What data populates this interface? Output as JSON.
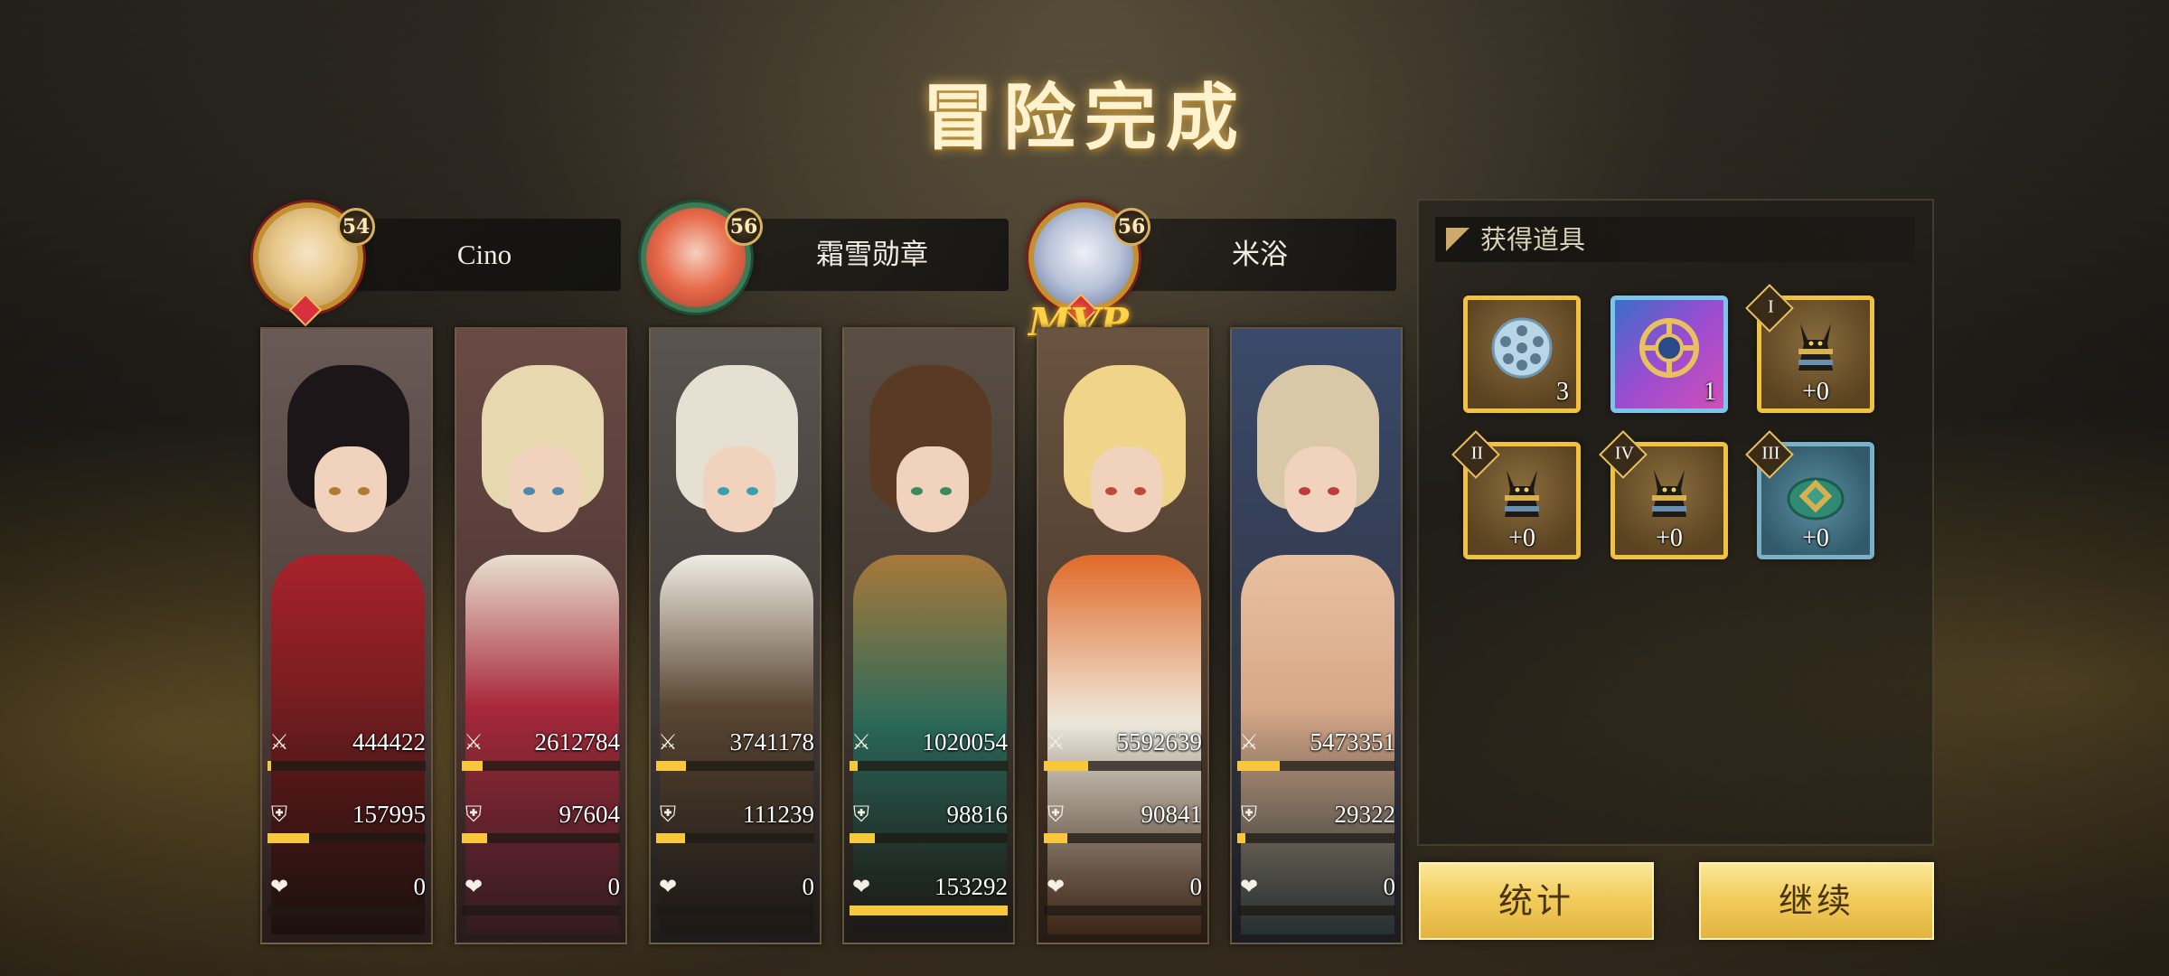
{
  "title": "冒险完成",
  "mvp_label": "MVP",
  "players": [
    {
      "name": "Cino",
      "level": "54"
    },
    {
      "name": "霜雪勋章",
      "level": "56"
    },
    {
      "name": "米浴",
      "level": "56"
    }
  ],
  "heroes": [
    {
      "damage": "444422",
      "damage_fill": 0.02,
      "defense": "157995",
      "defense_fill": 0.26,
      "heal": "0",
      "heal_fill": 0
    },
    {
      "damage": "2612784",
      "damage_fill": 0.13,
      "defense": "97604",
      "defense_fill": 0.16,
      "heal": "0",
      "heal_fill": 0
    },
    {
      "damage": "3741178",
      "damage_fill": 0.19,
      "defense": "111239",
      "defense_fill": 0.18,
      "heal": "0",
      "heal_fill": 0
    },
    {
      "damage": "1020054",
      "damage_fill": 0.05,
      "defense": "98816",
      "defense_fill": 0.16,
      "heal": "153292",
      "heal_fill": 1.0
    },
    {
      "damage": "5592639",
      "damage_fill": 0.28,
      "defense": "90841",
      "defense_fill": 0.15,
      "heal": "0",
      "heal_fill": 0
    },
    {
      "damage": "5473351",
      "damage_fill": 0.27,
      "defense": "29322",
      "defense_fill": 0.05,
      "heal": "0",
      "heal_fill": 0
    }
  ],
  "rewards": {
    "header": "获得道具",
    "items": [
      {
        "icon": "film-reel-icon",
        "qty": "3",
        "rarity": "gold"
      },
      {
        "icon": "gear-target-icon",
        "qty": "1",
        "rarity": "rainbow"
      },
      {
        "icon": "anubis-icon",
        "qty": "+0",
        "tier": "I",
        "rarity": "gold"
      },
      {
        "icon": "anubis-icon",
        "qty": "+0",
        "tier": "II",
        "rarity": "gold"
      },
      {
        "icon": "anubis-icon",
        "qty": "+0",
        "tier": "IV",
        "rarity": "gold"
      },
      {
        "icon": "jade-emblem-icon",
        "qty": "+0",
        "tier": "III",
        "rarity": "teal"
      }
    ]
  },
  "buttons": {
    "stats": "统计",
    "continue": "继续"
  },
  "colors": {
    "bar_fill": "#f6c83a",
    "button_gold": "#f2cd5c",
    "title_glow": "#ffc85a"
  }
}
